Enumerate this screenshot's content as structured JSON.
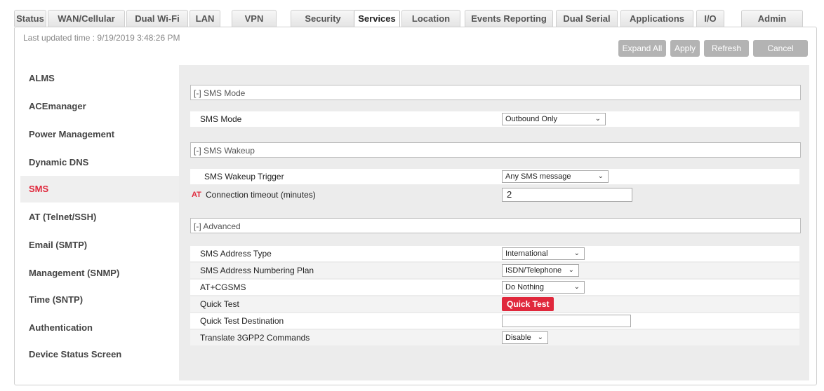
{
  "tabs": [
    {
      "label": "Status"
    },
    {
      "label": "WAN/Cellular"
    },
    {
      "label": "Dual Wi-Fi"
    },
    {
      "label": "LAN"
    },
    {
      "label": "VPN"
    },
    {
      "label": "Security"
    },
    {
      "label": "Services",
      "active": true
    },
    {
      "label": "Location"
    },
    {
      "label": "Events Reporting"
    },
    {
      "label": "Dual Serial"
    },
    {
      "label": "Applications"
    },
    {
      "label": "I/O"
    },
    {
      "label": "Admin"
    }
  ],
  "header": {
    "last_updated": "Last updated time : 9/19/2019 3:48:26 PM"
  },
  "toolbar": {
    "expand_all": "Expand All",
    "apply": "Apply",
    "refresh": "Refresh",
    "cancel": "Cancel"
  },
  "sidebar": {
    "items": [
      {
        "label": "ALMS"
      },
      {
        "label": "ACEmanager"
      },
      {
        "label": "Power Management"
      },
      {
        "label": "Dynamic DNS"
      },
      {
        "label": "SMS",
        "active": true
      },
      {
        "label": "AT (Telnet/SSH)"
      },
      {
        "label": "Email (SMTP)"
      },
      {
        "label": "Management (SNMP)"
      },
      {
        "label": "Time (SNTP)"
      },
      {
        "label": "Authentication"
      },
      {
        "label": "Device Status Screen"
      }
    ]
  },
  "sections": {
    "sms_mode": {
      "header": "[-] SMS Mode",
      "sms_mode_label": "SMS Mode",
      "sms_mode_value": "Outbound Only"
    },
    "sms_wakeup": {
      "header": "[-] SMS Wakeup",
      "trigger_label": "SMS Wakeup Trigger",
      "trigger_value": "Any SMS message",
      "at_badge": "AT",
      "timeout_label": "Connection timeout (minutes)",
      "timeout_value": "2"
    },
    "advanced": {
      "header": "[-] Advanced",
      "address_type_label": "SMS Address Type",
      "address_type_value": "International",
      "numbering_plan_label": "SMS Address Numbering Plan",
      "numbering_plan_value": "ISDN/Telephone",
      "cgsms_label": "AT+CGSMS",
      "cgsms_value": "Do Nothing",
      "quick_test_label": "Quick Test",
      "quick_test_button": "Quick Test",
      "quick_test_dest_label": "Quick Test Destination",
      "quick_test_dest_value": "",
      "translate_label": "Translate 3GPP2 Commands",
      "translate_value": "Disable"
    }
  },
  "icons": {
    "dropdown": "chevron-down-icon"
  },
  "colors": {
    "accent": "#e0283c",
    "button_gray": "#b3b3b3",
    "content_bg": "#ececec"
  }
}
